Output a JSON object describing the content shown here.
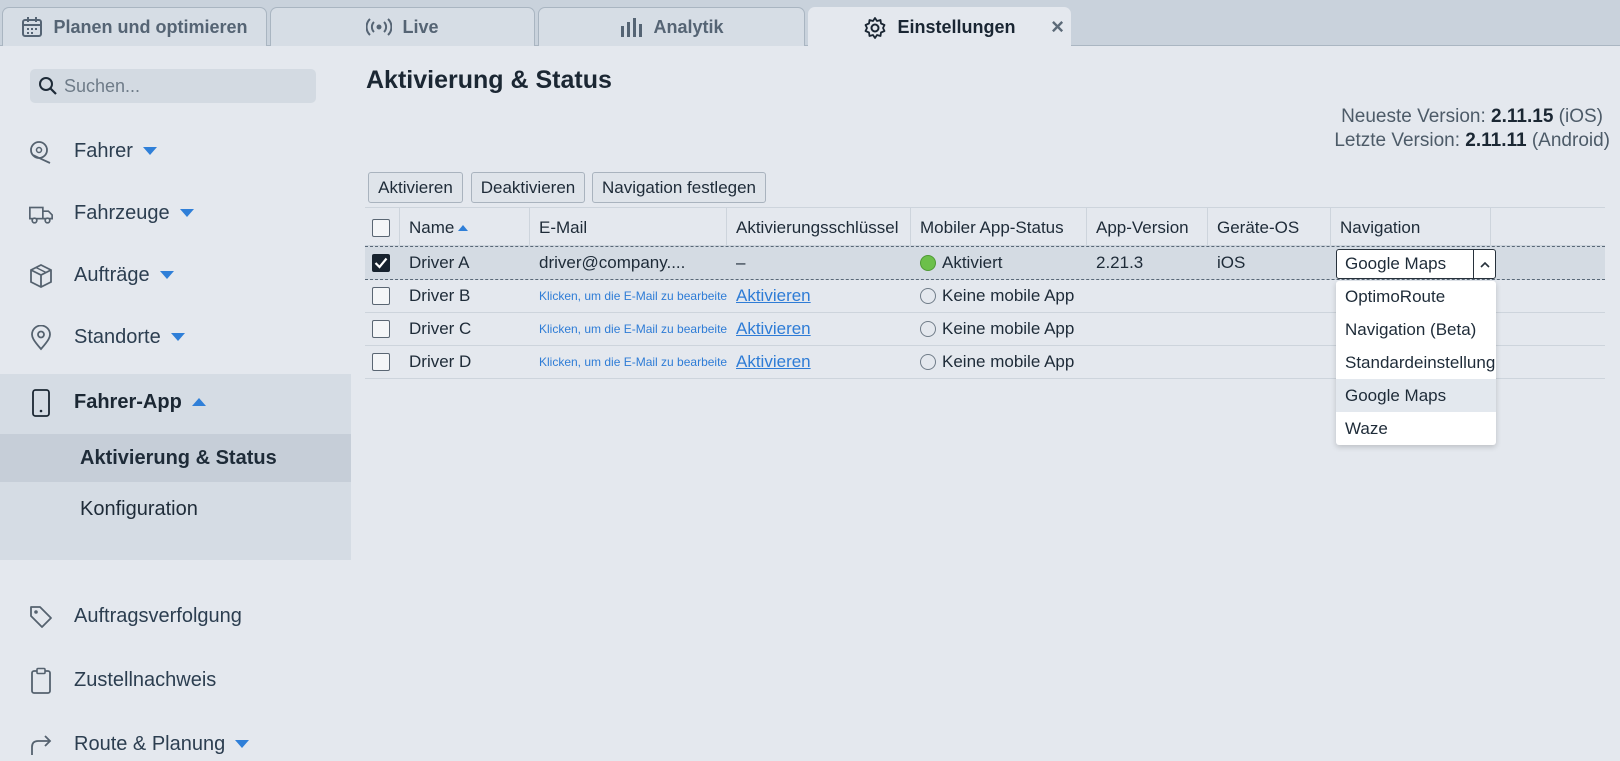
{
  "tabs": [
    {
      "label": "Planen und optimieren",
      "icon": "calendar-icon"
    },
    {
      "label": "Live",
      "icon": "broadcast-icon"
    },
    {
      "label": "Analytik",
      "icon": "bar-chart-icon"
    },
    {
      "label": "Einstellungen",
      "icon": "gear-icon",
      "active": true
    }
  ],
  "tab_close": "×",
  "sidebar": {
    "search_placeholder": "Suchen...",
    "items": [
      {
        "label": "Fahrer",
        "icon": "driver-icon"
      },
      {
        "label": "Fahrzeuge",
        "icon": "truck-icon"
      },
      {
        "label": "Aufträge",
        "icon": "box-icon"
      },
      {
        "label": "Standorte",
        "icon": "location-pin-icon"
      },
      {
        "label": "Fahrer-App",
        "icon": "phone-icon"
      },
      {
        "label": "Auftragsverfolgung",
        "icon": "tag-icon"
      },
      {
        "label": "Zustellnachweis",
        "icon": "clipboard-icon"
      },
      {
        "label": "Route & Planung",
        "icon": "route-arrow-icon"
      }
    ],
    "subitems": [
      "Aktivierung & Status",
      "Konfiguration"
    ]
  },
  "main": {
    "title": "Aktivierung & Status",
    "latest_label": "Neueste Version: ",
    "latest_version": "2.11.15",
    "latest_platform": " (iOS)",
    "last_label": "Letzte Version: ",
    "last_version": "2.11.11",
    "last_platform": " (Android)",
    "buttons": [
      "Aktivieren",
      "Deaktivieren",
      "Navigation festlegen"
    ]
  },
  "table": {
    "columns": [
      "Name",
      "E-Mail",
      "Aktivierungsschlüssel",
      "Mobiler App-Status",
      "App-Version",
      "Geräte-OS",
      "Navigation"
    ],
    "rows": [
      {
        "checked": true,
        "name": "Driver A",
        "email": "driver@company....",
        "key": "–",
        "status": "Aktiviert",
        "status_color": "#6cc04a",
        "app_version": "2.21.3",
        "os": "iOS",
        "navigation": "Google Maps"
      },
      {
        "checked": false,
        "name": "Driver B",
        "email": "Klicken, um die E-Mail zu bearbeiten",
        "key": "Aktivieren",
        "status": "Keine mobile App",
        "app_version": "",
        "os": "",
        "navigation": ""
      },
      {
        "checked": false,
        "name": "Driver C",
        "email": "Klicken, um die E-Mail zu bearbeiten",
        "key": "Aktivieren",
        "status": "Keine mobile App",
        "app_version": "",
        "os": "",
        "navigation": ""
      },
      {
        "checked": false,
        "name": "Driver D",
        "email": "Klicken, um die E-Mail zu bearbeiten",
        "key": "Aktivieren",
        "status": "Keine mobile App",
        "app_version": "",
        "os": "",
        "navigation": ""
      }
    ]
  },
  "navigation_dropdown": {
    "selected": "Google Maps",
    "options": [
      "OptimoRoute",
      "Navigation (Beta)",
      "Standardeinstellung",
      "Google Maps",
      "Waze"
    ]
  },
  "colors": {
    "accent": "#2f7fd8",
    "link": "#2e7cd6",
    "active_green": "#6cc04a"
  }
}
